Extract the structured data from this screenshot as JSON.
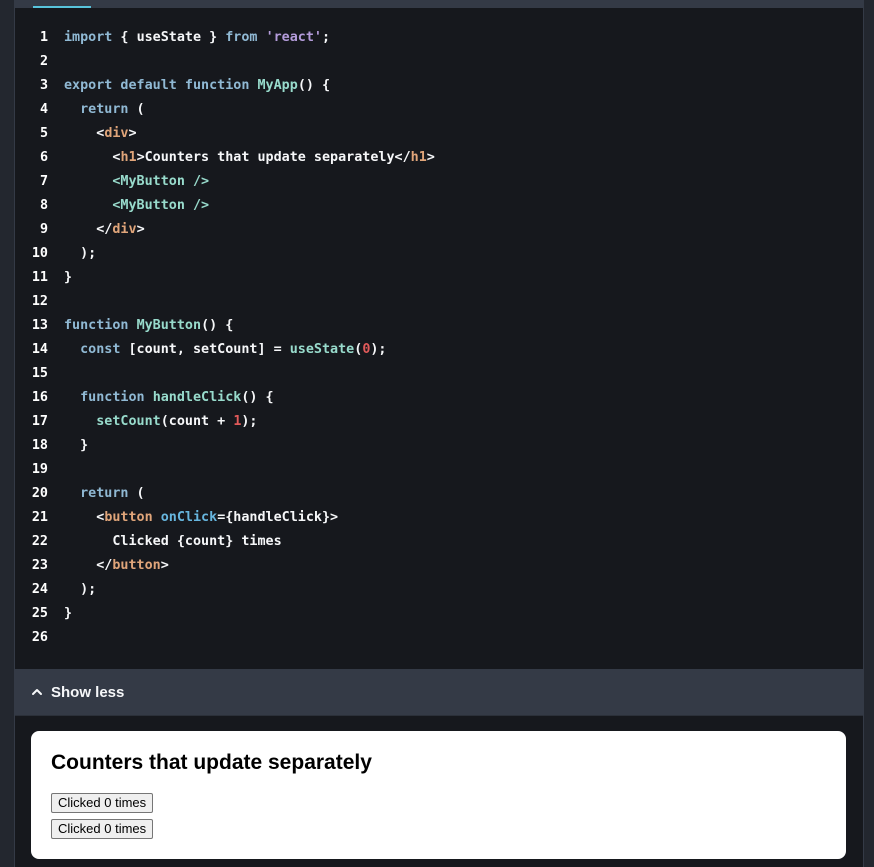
{
  "code": {
    "lines": [
      {
        "n": "1"
      },
      {
        "n": "2"
      },
      {
        "n": "3"
      },
      {
        "n": "4"
      },
      {
        "n": "5"
      },
      {
        "n": "6"
      },
      {
        "n": "7"
      },
      {
        "n": "8"
      },
      {
        "n": "9"
      },
      {
        "n": "10"
      },
      {
        "n": "11"
      },
      {
        "n": "12"
      },
      {
        "n": "13"
      },
      {
        "n": "14"
      },
      {
        "n": "15"
      },
      {
        "n": "16"
      },
      {
        "n": "17"
      },
      {
        "n": "18"
      },
      {
        "n": "19"
      },
      {
        "n": "20"
      },
      {
        "n": "21"
      },
      {
        "n": "22"
      },
      {
        "n": "23"
      },
      {
        "n": "24"
      },
      {
        "n": "25"
      },
      {
        "n": "26"
      }
    ],
    "t": {
      "import": "import",
      "lbrace_sp": " { ",
      "useState": "useState",
      "rbrace_sp": " } ",
      "from": "from",
      "react_str": "'react'",
      "semi": ";",
      "export_default_function": "export default function",
      "MyApp": "MyApp",
      "parens_brace": "() {",
      "return": "return",
      "paren_open": " (",
      "lt": "<",
      "gt": ">",
      "close_open": "</",
      "div": "div",
      "h1": "h1",
      "h1_text": "Counters that update separately",
      "MyButton_tag": "<MyButton />",
      "close_paren_semi": ");",
      "rbrace": "}",
      "function": "function",
      "MyButton": "MyButton",
      "const": "const",
      "destructure": " [count, setCount] = ",
      "paren_l": "(",
      "zero": "0",
      "paren_r_semi": ");",
      "handleClick": "handleClick",
      "setCount": "setCount",
      "count_plus": "(count + ",
      "one": "1",
      "button": "button",
      "onClick": "onClick",
      "onclick_val": "={handleClick}>",
      "clicked_expr": "Clicked {count} times"
    }
  },
  "toolbar": {
    "show_less_label": "Show less"
  },
  "preview": {
    "heading": "Counters that update separately",
    "buttons": [
      "Clicked 0 times",
      "Clicked 0 times"
    ]
  },
  "colors": {
    "editor_bg": "#16181d",
    "keyword": "#90b9d4",
    "string": "#b49cdb",
    "function_name": "#98dbcc",
    "tag": "#e0a57a",
    "number": "#e15a5a",
    "accent": "#58c4dc"
  },
  "icons": {
    "show_less": "chevron-up-icon"
  }
}
